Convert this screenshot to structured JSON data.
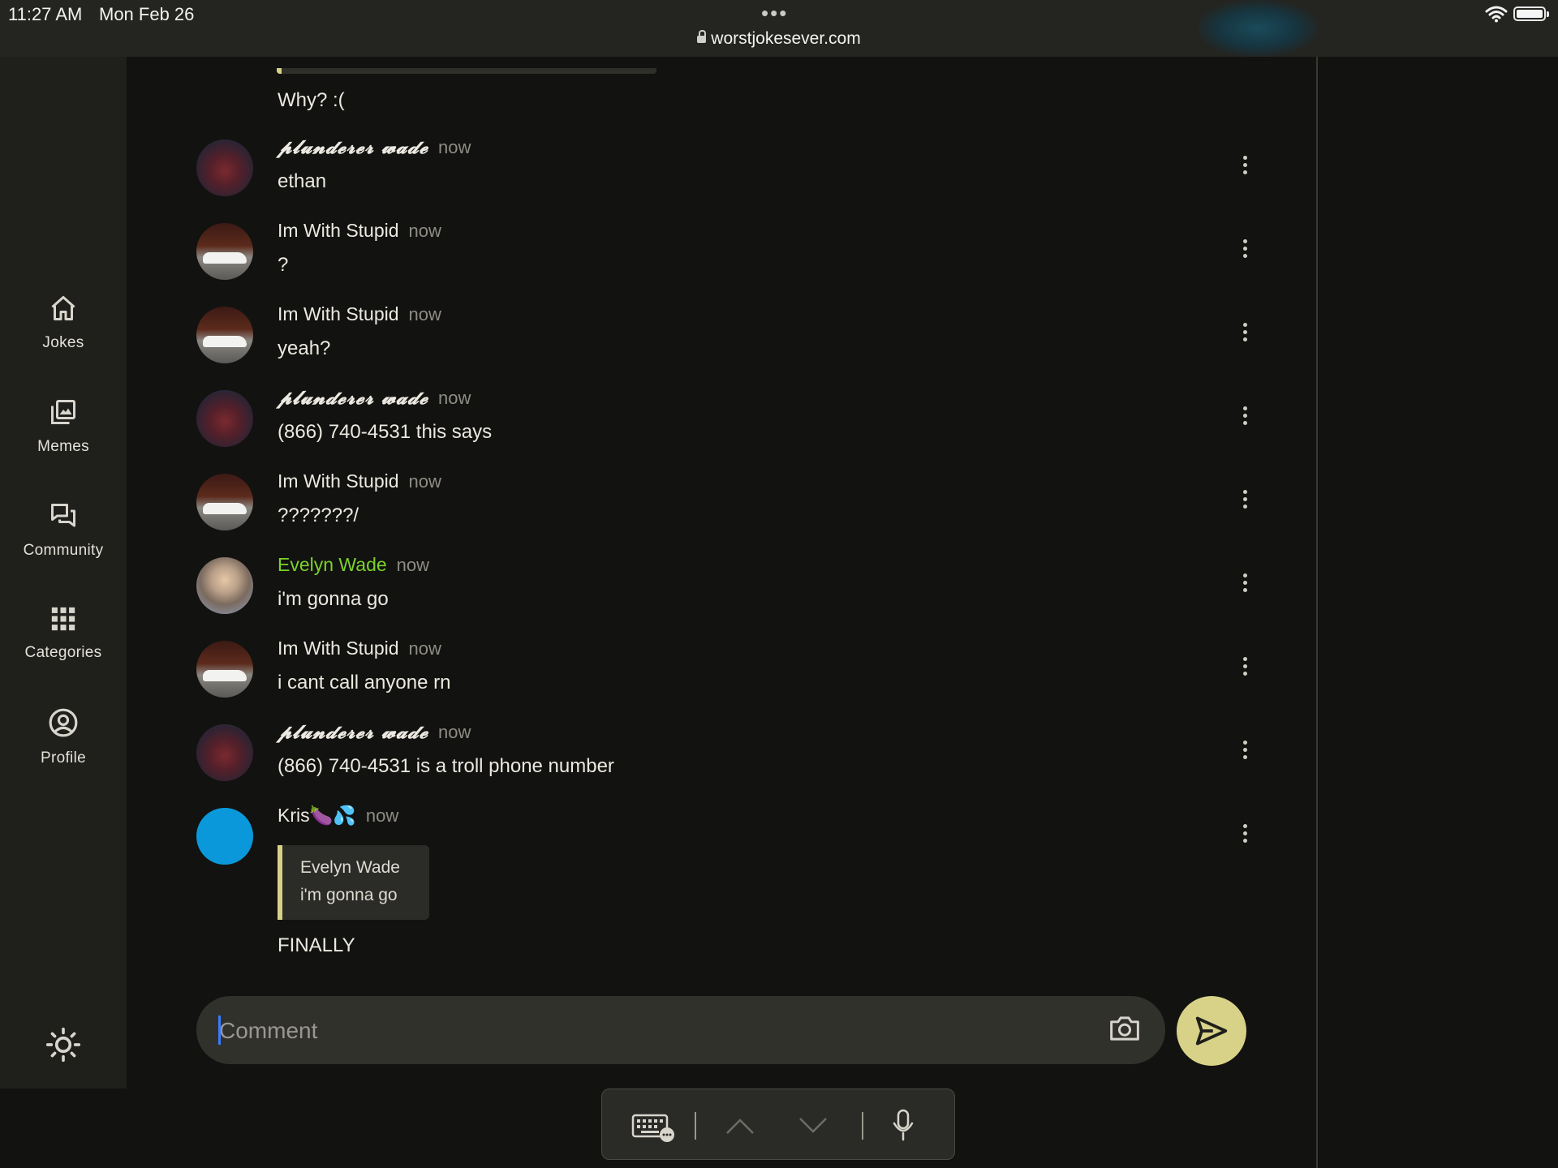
{
  "status_bar": {
    "time": "11:27 AM",
    "date": "Mon Feb 26",
    "url": "worstjokesever.com",
    "icons": [
      "more-dots-icon",
      "lock-icon",
      "wifi-icon",
      "battery-icon"
    ]
  },
  "sidebar": {
    "items": [
      {
        "label": "Jokes",
        "icon": "home-icon"
      },
      {
        "label": "Memes",
        "icon": "image-gallery-icon"
      },
      {
        "label": "Community",
        "icon": "chat-bubbles-icon"
      },
      {
        "label": "Categories",
        "icon": "grid-icon"
      },
      {
        "label": "Profile",
        "icon": "user-circle-icon"
      }
    ],
    "theme_icon": "sun-icon"
  },
  "chat": {
    "orphan_text": "Why? :(",
    "messages": [
      {
        "author": "𝓹𝓵𝓾𝓷𝓭𝓮𝓻𝓮𝓻 𝔀𝓪𝓭𝓮",
        "time": "now",
        "text": "ethan"
      },
      {
        "author": "Im With Stupid",
        "time": "now",
        "text": "?"
      },
      {
        "author": "Im With Stupid",
        "time": "now",
        "text": "yeah?"
      },
      {
        "author": "𝓹𝓵𝓾𝓷𝓭𝓮𝓻𝓮𝓻 𝔀𝓪𝓭𝓮",
        "time": "now",
        "text": "(866) 740-4531 this says"
      },
      {
        "author": "Im With Stupid",
        "time": "now",
        "text": "???????/"
      },
      {
        "author": "Evelyn Wade",
        "time": "now",
        "text": "i'm gonna go",
        "author_color": "#7bd22c"
      },
      {
        "author": "Im With Stupid",
        "time": "now",
        "text": "i cant call anyone rn"
      },
      {
        "author": "𝓹𝓵𝓾𝓷𝓭𝓮𝓻𝓮𝓻 𝔀𝓪𝓭𝓮",
        "time": "now",
        "text": "(866) 740-4531 is a troll phone number"
      },
      {
        "author": "Kris🍆💦",
        "time": "now",
        "reply_to": {
          "author": "Evelyn Wade",
          "text": "i'm gonna go"
        },
        "text": "FINALLY"
      }
    ]
  },
  "composer": {
    "placeholder": "Comment",
    "icons": [
      "camera-icon",
      "send-icon"
    ]
  },
  "keyboard_bar": {
    "icons": [
      "keyboard-icon",
      "chevron-up-icon",
      "chevron-down-icon",
      "microphone-icon"
    ]
  },
  "colors": {
    "accent": "#d7d287",
    "background": "#121210",
    "sidebar": "#1f1f1c",
    "highlight_name": "#7bd22c",
    "avatar_blue": "#0a98db"
  }
}
